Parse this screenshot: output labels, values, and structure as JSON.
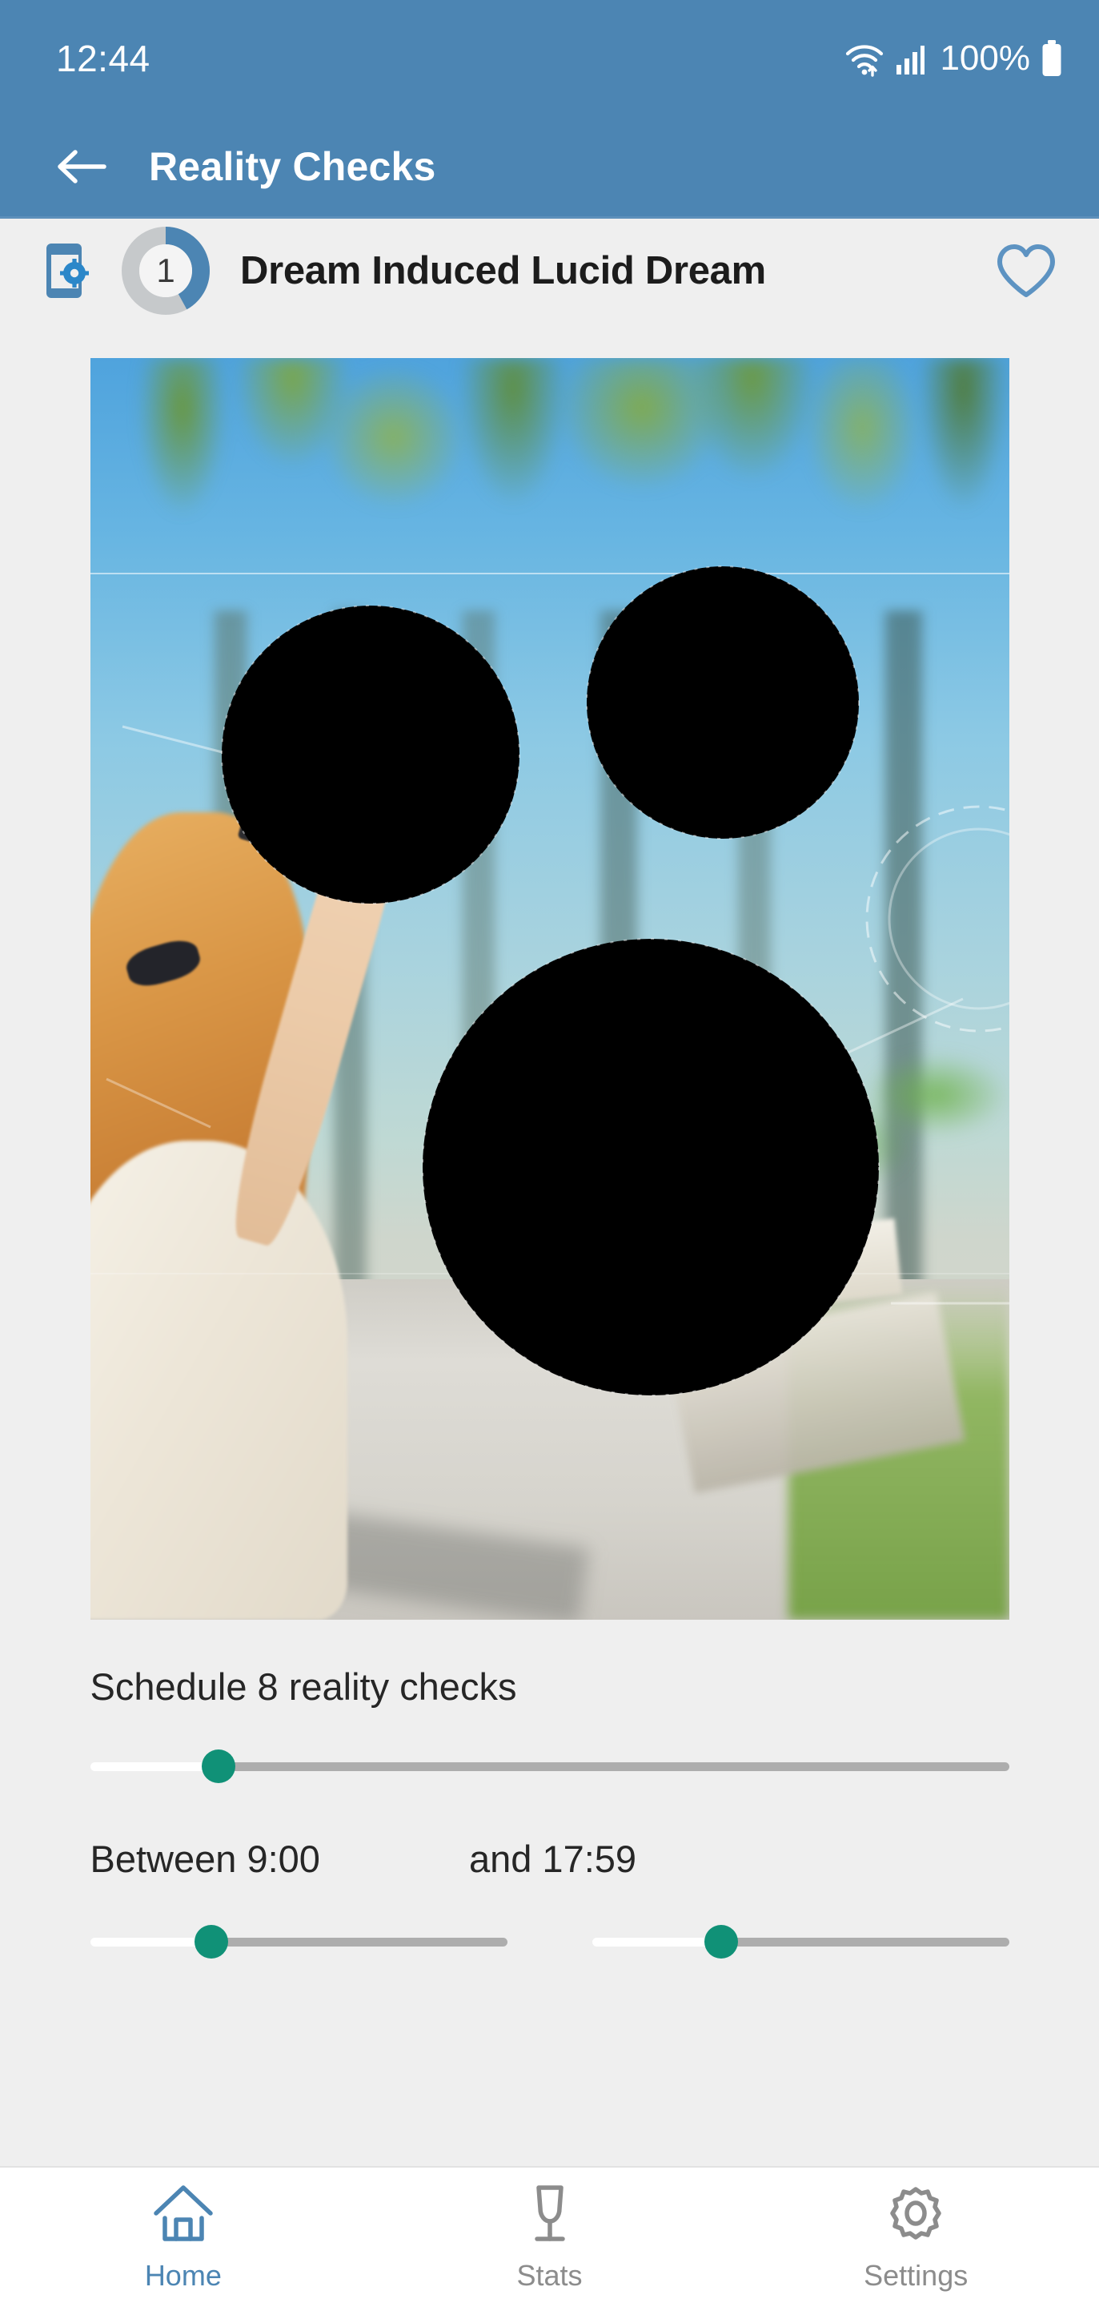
{
  "status_bar": {
    "time": "12:44",
    "battery_percent": "100%",
    "icons": [
      "wifi-icon",
      "cellular-signal-icon",
      "battery-icon"
    ]
  },
  "app_bar": {
    "back_icon": "arrow-left-icon",
    "title": "Reality Checks"
  },
  "card_header": {
    "phone_settings_icon": "phone-gear-icon",
    "counter": "1",
    "counter_progress_percent": 42,
    "title": "Dream Induced Lucid Dream",
    "favorite_icon": "heart-outline-icon"
  },
  "media": {
    "alt": "Woman pointing at sky with palm trees and HUD technology overlay"
  },
  "schedule": {
    "label": "Schedule 8 reality checks",
    "count": 8,
    "slider_percent": 14
  },
  "time_range": {
    "start_label": "Between 9:00",
    "end_label": "and 17:59",
    "start_time": "9:00",
    "end_time": "17:59",
    "start_slider_percent": 29,
    "end_slider_percent": 31
  },
  "bottom_nav": {
    "items": [
      {
        "label": "Home",
        "icon": "home-icon",
        "active": true
      },
      {
        "label": "Stats",
        "icon": "trophy-icon",
        "active": false
      },
      {
        "label": "Settings",
        "icon": "gear-icon",
        "active": false
      }
    ]
  },
  "colors": {
    "app_bar_blue": "#4C85B3",
    "accent_green": "#109177",
    "content_bg": "#EFEFEF",
    "nav_bg": "#FFFFFF",
    "inactive_gray": "#8C8C8C"
  }
}
